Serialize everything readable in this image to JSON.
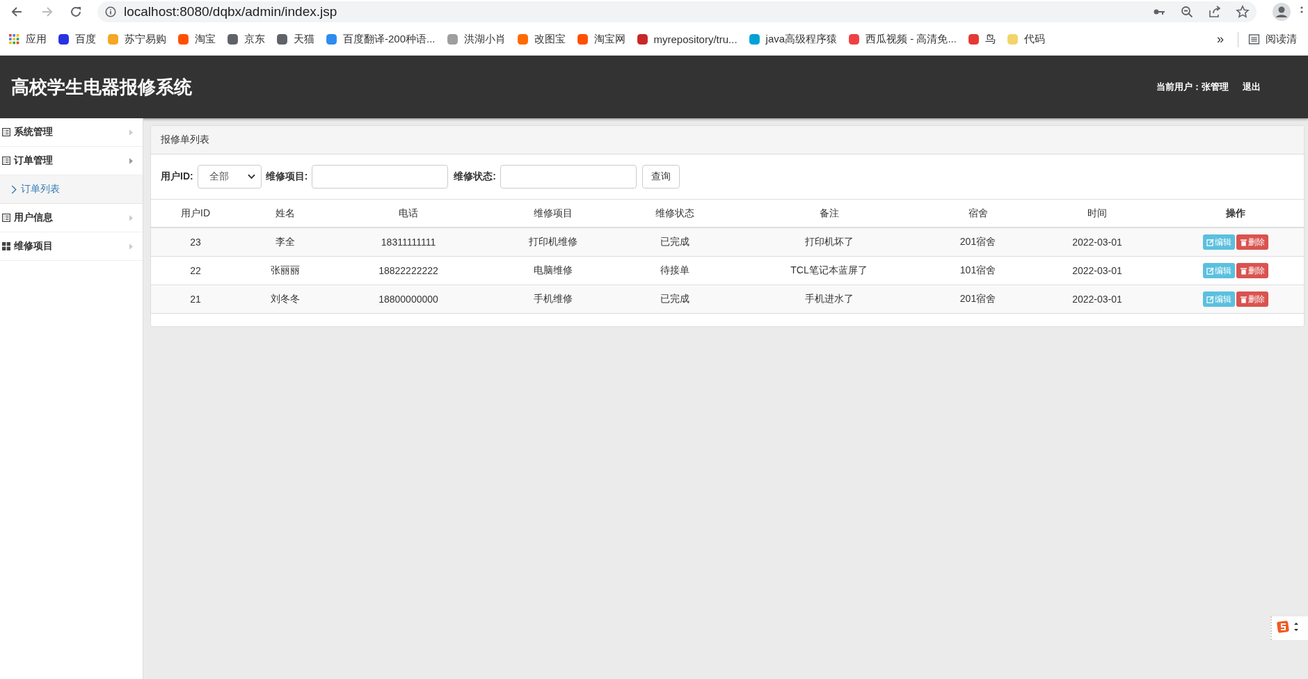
{
  "browser": {
    "url": "localhost:8080/dqbx/admin/index.jsp",
    "bookmarks": [
      {
        "label": "应用",
        "kind": "apps"
      },
      {
        "label": "百度",
        "kind": "site",
        "color": "#2932e1"
      },
      {
        "label": "苏宁易购",
        "kind": "site",
        "color": "#f5a623"
      },
      {
        "label": "淘宝",
        "kind": "site",
        "color": "#ff5000"
      },
      {
        "label": "京东",
        "kind": "site",
        "color": "#5f6368"
      },
      {
        "label": "天猫",
        "kind": "site",
        "color": "#5f6368"
      },
      {
        "label": "百度翻译-200种语...",
        "kind": "site",
        "color": "#2d8cf0"
      },
      {
        "label": "洪湖小肖",
        "kind": "site",
        "color": "#9e9e9e"
      },
      {
        "label": "改图宝",
        "kind": "site",
        "color": "#ff6a00"
      },
      {
        "label": "淘宝网",
        "kind": "site",
        "color": "#ff5000"
      },
      {
        "label": "myrepository/tru...",
        "kind": "site",
        "color": "#c62828"
      },
      {
        "label": "java高级程序猿",
        "kind": "site",
        "color": "#00a1d6"
      },
      {
        "label": "西瓜视频 - 高清免...",
        "kind": "site",
        "color": "#f04142"
      },
      {
        "label": "鸟",
        "kind": "site",
        "color": "#e53935"
      },
      {
        "label": "代码",
        "kind": "site",
        "color": "#f3d46a"
      }
    ],
    "overflow": "»",
    "reading_list": "阅读清"
  },
  "app": {
    "title": "高校学生电器报修系统",
    "current_user": "当前用户：张管理",
    "logout": "退出"
  },
  "sidebar": {
    "items": [
      {
        "label": "系统管理",
        "kind": "list",
        "selected": false,
        "expanded": false
      },
      {
        "label": "订单管理",
        "kind": "list",
        "selected": false,
        "expanded": true,
        "children": [
          {
            "label": "订单列表",
            "selected": true
          }
        ]
      },
      {
        "label": "用户信息",
        "kind": "list",
        "selected": false,
        "expanded": false
      },
      {
        "label": "维修项目",
        "kind": "grid",
        "selected": false,
        "expanded": false
      }
    ]
  },
  "panel": {
    "title": "报修单列表",
    "filters": [
      {
        "label": "用户ID:",
        "kind": "select",
        "value": "全部"
      },
      {
        "label": "维修项目:",
        "kind": "text"
      },
      {
        "label": "维修状态:",
        "kind": "text"
      }
    ],
    "search_button": "查询",
    "table": {
      "columns": [
        "用户ID",
        "姓名",
        "电话",
        "维修项目",
        "维修状态",
        "备注",
        "宿舍",
        "时间",
        "操作"
      ],
      "rows": [
        {
          "cells": [
            "23",
            "李全",
            "18311111111",
            "打印机维修",
            "已完成",
            "打印机坏了",
            "201宿舍",
            "2022-03-01"
          ],
          "actions": [
            {
              "label": "编辑",
              "kind": "edit"
            },
            {
              "label": "删除",
              "kind": "delete"
            }
          ]
        },
        {
          "cells": [
            "22",
            "张丽丽",
            "18822222222",
            "电脑维修",
            "待接单",
            "TCL笔记本蓝屏了",
            "101宿舍",
            "2022-03-01"
          ],
          "actions": [
            {
              "label": "编辑",
              "kind": "edit"
            },
            {
              "label": "删除",
              "kind": "delete"
            }
          ]
        },
        {
          "cells": [
            "21",
            "刘冬冬",
            "18800000000",
            "手机维修",
            "已完成",
            "手机进水了",
            "201宿舍",
            "2022-03-01"
          ],
          "actions": [
            {
              "label": "编辑",
              "kind": "edit"
            },
            {
              "label": "删除",
              "kind": "delete"
            }
          ]
        }
      ]
    }
  }
}
